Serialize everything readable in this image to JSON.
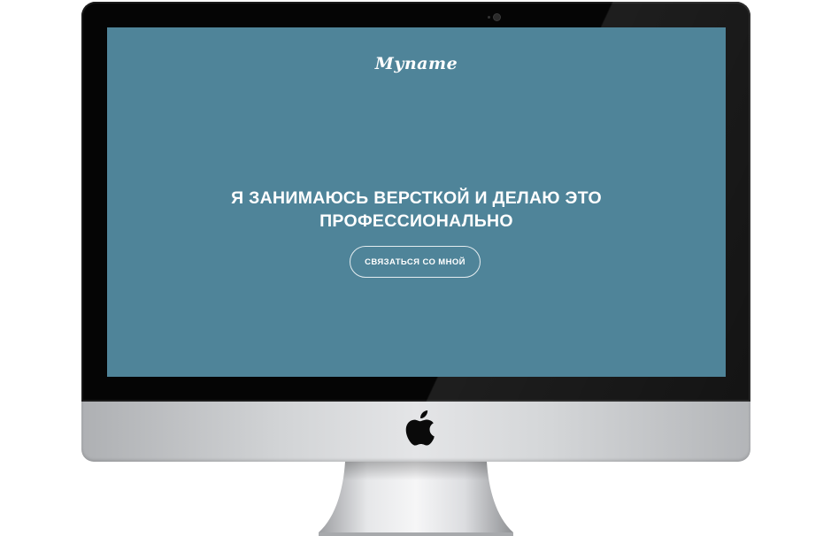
{
  "site": {
    "logo": "Myname",
    "headline_line1": "Я ЗАНИМАЮСЬ ВЕРСТКОЙ И ДЕЛАЮ ЭТО",
    "headline_line2": "ПРОФЕССИОНАЛЬНО",
    "cta_label": "СВЯЗАТЬСЯ СО МНОЙ"
  },
  "colors": {
    "screen_background": "#4f8499",
    "text": "#ffffff",
    "bezel": "#050505",
    "chin_silver": "#d2d4d6",
    "apple_logo": "#0a0a0a"
  },
  "icons": {
    "brand": "apple-logo-icon",
    "camera": "camera-icon"
  }
}
